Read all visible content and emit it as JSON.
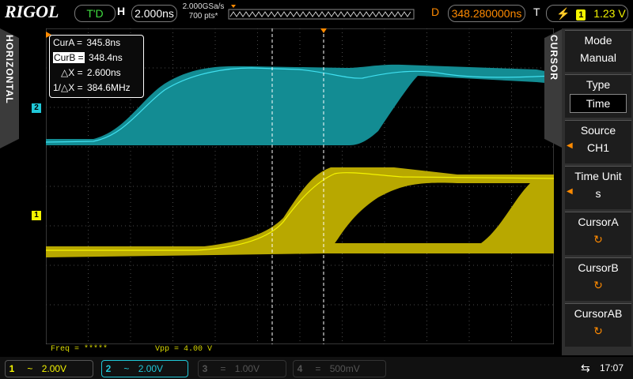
{
  "brand": "RIGOL",
  "run_state": "T'D",
  "horizontal": {
    "label": "H",
    "timebase": "2.000ns",
    "sample_rate": "2.000GSa/s",
    "points": "700 pts*"
  },
  "delay": {
    "label": "D",
    "value": "348.280000ns"
  },
  "trigger": {
    "label": "T",
    "slope_icon": "rising-edge-icon",
    "source": "1",
    "level": "1.23 V"
  },
  "left_tab": "HORIZONTAL",
  "menu": {
    "tab": "CURSOR",
    "items": [
      {
        "title": "Mode",
        "value": "Manual"
      },
      {
        "title": "Type",
        "value": "Time"
      },
      {
        "title": "Source",
        "value": "CH1"
      },
      {
        "title": "Time Unit",
        "value": "s"
      },
      {
        "title": "CursorA",
        "value": "↻"
      },
      {
        "title": "CursorB",
        "value": "↻"
      },
      {
        "title": "CursorAB",
        "value": "↻"
      }
    ]
  },
  "cursor_readout": {
    "cura_label": "CurA =",
    "cura_value": "345.8ns",
    "curb_label": "CurB =",
    "curb_value": "348.4ns",
    "dx_label": "△X =",
    "dx_value": "2.600ns",
    "inv_label": "1/△X =",
    "inv_value": "384.6MHz"
  },
  "measurements": {
    "freq": "Freq = *****",
    "vpp": "Vpp = 4.00 V"
  },
  "channels": [
    {
      "num": "1",
      "coupling": "~",
      "scale": "2.00V",
      "color": "#f4f400",
      "active": true
    },
    {
      "num": "2",
      "coupling": "~",
      "scale": "2.00V",
      "color": "#20c8d8",
      "active": true
    },
    {
      "num": "3",
      "coupling": "=",
      "scale": "1.00V",
      "color": "#555555",
      "active": false
    },
    {
      "num": "4",
      "coupling": "=",
      "scale": "500mV",
      "color": "#555555",
      "active": false
    }
  ],
  "clock": "17:07",
  "markers": {
    "ch1": "1",
    "ch2": "2"
  },
  "colors": {
    "ch1": "#b8a800",
    "ch1_trace": "#f4f400",
    "ch2": "#138c93",
    "ch2_trace": "#40e0f0",
    "accent": "#ff8a00",
    "grid": "#5a5a5a"
  }
}
